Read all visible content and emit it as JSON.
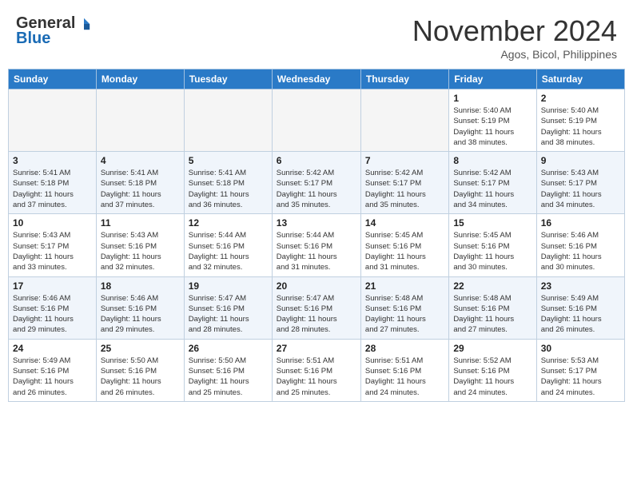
{
  "header": {
    "logo_general": "General",
    "logo_blue": "Blue",
    "month_title": "November 2024",
    "subtitle": "Agos, Bicol, Philippines"
  },
  "weekdays": [
    "Sunday",
    "Monday",
    "Tuesday",
    "Wednesday",
    "Thursday",
    "Friday",
    "Saturday"
  ],
  "weeks": [
    [
      {
        "day": "",
        "info": ""
      },
      {
        "day": "",
        "info": ""
      },
      {
        "day": "",
        "info": ""
      },
      {
        "day": "",
        "info": ""
      },
      {
        "day": "",
        "info": ""
      },
      {
        "day": "1",
        "info": "Sunrise: 5:40 AM\nSunset: 5:19 PM\nDaylight: 11 hours\nand 38 minutes."
      },
      {
        "day": "2",
        "info": "Sunrise: 5:40 AM\nSunset: 5:19 PM\nDaylight: 11 hours\nand 38 minutes."
      }
    ],
    [
      {
        "day": "3",
        "info": "Sunrise: 5:41 AM\nSunset: 5:18 PM\nDaylight: 11 hours\nand 37 minutes."
      },
      {
        "day": "4",
        "info": "Sunrise: 5:41 AM\nSunset: 5:18 PM\nDaylight: 11 hours\nand 37 minutes."
      },
      {
        "day": "5",
        "info": "Sunrise: 5:41 AM\nSunset: 5:18 PM\nDaylight: 11 hours\nand 36 minutes."
      },
      {
        "day": "6",
        "info": "Sunrise: 5:42 AM\nSunset: 5:17 PM\nDaylight: 11 hours\nand 35 minutes."
      },
      {
        "day": "7",
        "info": "Sunrise: 5:42 AM\nSunset: 5:17 PM\nDaylight: 11 hours\nand 35 minutes."
      },
      {
        "day": "8",
        "info": "Sunrise: 5:42 AM\nSunset: 5:17 PM\nDaylight: 11 hours\nand 34 minutes."
      },
      {
        "day": "9",
        "info": "Sunrise: 5:43 AM\nSunset: 5:17 PM\nDaylight: 11 hours\nand 34 minutes."
      }
    ],
    [
      {
        "day": "10",
        "info": "Sunrise: 5:43 AM\nSunset: 5:17 PM\nDaylight: 11 hours\nand 33 minutes."
      },
      {
        "day": "11",
        "info": "Sunrise: 5:43 AM\nSunset: 5:16 PM\nDaylight: 11 hours\nand 32 minutes."
      },
      {
        "day": "12",
        "info": "Sunrise: 5:44 AM\nSunset: 5:16 PM\nDaylight: 11 hours\nand 32 minutes."
      },
      {
        "day": "13",
        "info": "Sunrise: 5:44 AM\nSunset: 5:16 PM\nDaylight: 11 hours\nand 31 minutes."
      },
      {
        "day": "14",
        "info": "Sunrise: 5:45 AM\nSunset: 5:16 PM\nDaylight: 11 hours\nand 31 minutes."
      },
      {
        "day": "15",
        "info": "Sunrise: 5:45 AM\nSunset: 5:16 PM\nDaylight: 11 hours\nand 30 minutes."
      },
      {
        "day": "16",
        "info": "Sunrise: 5:46 AM\nSunset: 5:16 PM\nDaylight: 11 hours\nand 30 minutes."
      }
    ],
    [
      {
        "day": "17",
        "info": "Sunrise: 5:46 AM\nSunset: 5:16 PM\nDaylight: 11 hours\nand 29 minutes."
      },
      {
        "day": "18",
        "info": "Sunrise: 5:46 AM\nSunset: 5:16 PM\nDaylight: 11 hours\nand 29 minutes."
      },
      {
        "day": "19",
        "info": "Sunrise: 5:47 AM\nSunset: 5:16 PM\nDaylight: 11 hours\nand 28 minutes."
      },
      {
        "day": "20",
        "info": "Sunrise: 5:47 AM\nSunset: 5:16 PM\nDaylight: 11 hours\nand 28 minutes."
      },
      {
        "day": "21",
        "info": "Sunrise: 5:48 AM\nSunset: 5:16 PM\nDaylight: 11 hours\nand 27 minutes."
      },
      {
        "day": "22",
        "info": "Sunrise: 5:48 AM\nSunset: 5:16 PM\nDaylight: 11 hours\nand 27 minutes."
      },
      {
        "day": "23",
        "info": "Sunrise: 5:49 AM\nSunset: 5:16 PM\nDaylight: 11 hours\nand 26 minutes."
      }
    ],
    [
      {
        "day": "24",
        "info": "Sunrise: 5:49 AM\nSunset: 5:16 PM\nDaylight: 11 hours\nand 26 minutes."
      },
      {
        "day": "25",
        "info": "Sunrise: 5:50 AM\nSunset: 5:16 PM\nDaylight: 11 hours\nand 26 minutes."
      },
      {
        "day": "26",
        "info": "Sunrise: 5:50 AM\nSunset: 5:16 PM\nDaylight: 11 hours\nand 25 minutes."
      },
      {
        "day": "27",
        "info": "Sunrise: 5:51 AM\nSunset: 5:16 PM\nDaylight: 11 hours\nand 25 minutes."
      },
      {
        "day": "28",
        "info": "Sunrise: 5:51 AM\nSunset: 5:16 PM\nDaylight: 11 hours\nand 24 minutes."
      },
      {
        "day": "29",
        "info": "Sunrise: 5:52 AM\nSunset: 5:16 PM\nDaylight: 11 hours\nand 24 minutes."
      },
      {
        "day": "30",
        "info": "Sunrise: 5:53 AM\nSunset: 5:17 PM\nDaylight: 11 hours\nand 24 minutes."
      }
    ]
  ]
}
